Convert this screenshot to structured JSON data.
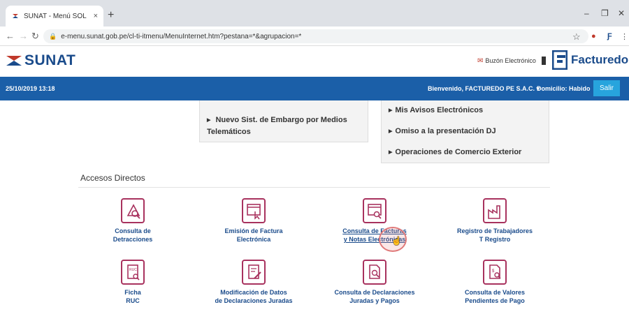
{
  "browser": {
    "tab_title": "SUNAT - Menú SOL",
    "tab_close": "×",
    "new_tab": "+",
    "url": "e-menu.sunat.gob.pe/cl-ti-itmenu/MenuInternet.htm?pestana=*&agrupacion=*",
    "win_min": "–",
    "win_max": "❐",
    "win_close": "✕"
  },
  "header": {
    "logo_text": "SUNAT",
    "buzon_label": "Buzón Electrónico",
    "partner_text": "Facturedo"
  },
  "bluebar": {
    "datetime": "25/10/2019 13:18",
    "welcome": "Bienvenido, FACTUREDO PE S.A.C.",
    "domicilio": "Domicilio: Habido",
    "salir": "Salir"
  },
  "menu_left": {
    "item1_line1": "Nuevo Sist. de Embargo por Medios",
    "item1_line2": "Telemáticos"
  },
  "menu_right": {
    "items": [
      "Mis Avisos Electrónicos",
      "Omiso a la presentación DJ",
      "Operaciones de Comercio Exterior"
    ]
  },
  "accesos": {
    "title": "Accesos Directos",
    "items": [
      {
        "line1": "Consulta de",
        "line2": "Detracciones",
        "icon": "detraccion-icon"
      },
      {
        "line1": "Emisión de Factura",
        "line2": "Electrónica",
        "icon": "factura-icon"
      },
      {
        "line1": "Consulta de Facturas",
        "line2": "y Notas Electrónicas",
        "icon": "consulta-factura-icon"
      },
      {
        "line1": "Registro de Trabajadores",
        "line2": "T Registro",
        "icon": "factory-icon"
      },
      {
        "line1": "Ficha",
        "line2": "RUC",
        "icon": "ruc-icon"
      },
      {
        "line1": "Modificación de Datos",
        "line2": "de Declaraciones Juradas",
        "icon": "edit-document-icon"
      },
      {
        "line1": "Consulta de Declaraciones",
        "line2": "Juradas y Pagos",
        "icon": "search-document-icon"
      },
      {
        "line1": "Consulta de Valores",
        "line2": "Pendientes de Pago",
        "icon": "pending-document-icon"
      }
    ]
  },
  "colors": {
    "brand_blue": "#1b5fa8",
    "salir_button": "#27a4dd",
    "icon_border": "#a8325e",
    "link_text": "#1a4b8b"
  }
}
